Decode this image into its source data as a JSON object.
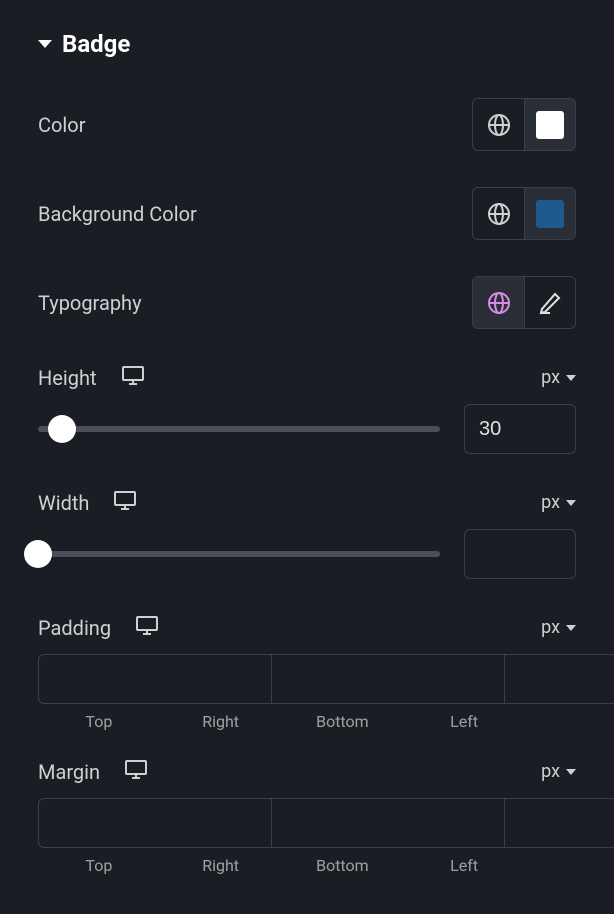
{
  "section": {
    "title": "Badge"
  },
  "color": {
    "label": "Color",
    "swatch": "#ffffff"
  },
  "bgcolor": {
    "label": "Background Color",
    "swatch": "#1e5a8e"
  },
  "typography": {
    "label": "Typography"
  },
  "height": {
    "label": "Height",
    "unit": "px",
    "value": "30",
    "sliderPercent": 6
  },
  "width": {
    "label": "Width",
    "unit": "px",
    "value": "",
    "sliderPercent": 0
  },
  "padding": {
    "label": "Padding",
    "unit": "px",
    "sides": {
      "top": "Top",
      "right": "Right",
      "bottom": "Bottom",
      "left": "Left"
    },
    "values": {
      "top": "",
      "right": "",
      "bottom": "",
      "left": ""
    }
  },
  "margin": {
    "label": "Margin",
    "unit": "px",
    "sides": {
      "top": "Top",
      "right": "Right",
      "bottom": "Bottom",
      "left": "Left"
    },
    "values": {
      "top": "",
      "right": "",
      "bottom": "",
      "left": ""
    }
  }
}
